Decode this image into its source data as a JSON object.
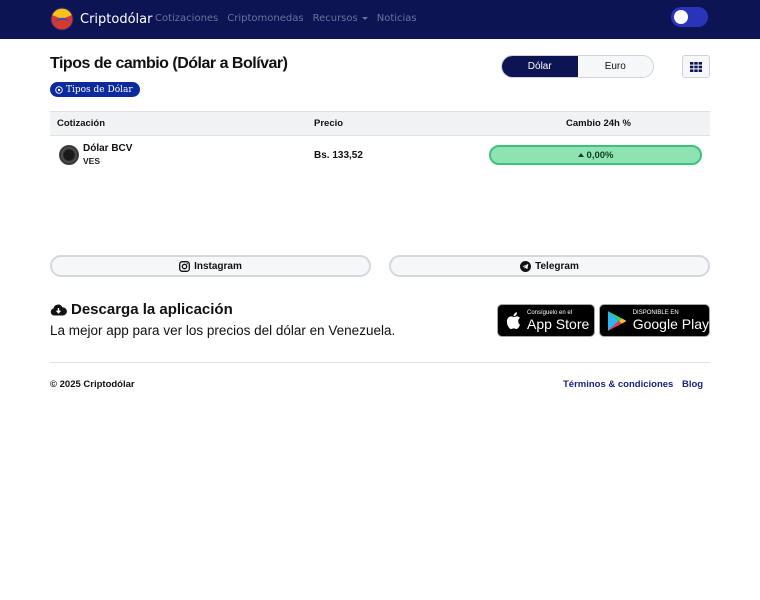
{
  "navbar": {
    "brand": "Criptodólar",
    "links": [
      "Cotizaciones",
      "Criptomonedas",
      "Recursos",
      "Noticias"
    ],
    "colors": {
      "background": "#0c1454",
      "link": "#6c7399",
      "toggle": "#2a34b8"
    }
  },
  "header": {
    "title": "Tipos de cambio (Dólar a Bolívar)",
    "currency_tabs": [
      {
        "label": "Dólar",
        "active": true
      },
      {
        "label": "Euro",
        "active": false
      }
    ],
    "grid_icon": "grid-icon",
    "badge": "Tipos de Dólar"
  },
  "table": {
    "columns": [
      "Cotización",
      "Precio",
      "Cambio 24h %"
    ],
    "rows": [
      {
        "name": "Dólar BCV",
        "code": "VES",
        "price": "Bs. 133,52",
        "change": "0,00%",
        "trend": "up"
      }
    ]
  },
  "social": {
    "instagram": "Instagram",
    "telegram": "Telegram"
  },
  "download": {
    "title": "Descarga la aplicación",
    "subtitle": "La mejor app para ver los precios del dólar en Venezuela.",
    "app_store_small": "Consíguelo en el",
    "app_store_big": "App Store",
    "google_play_small": "DISPONIBLE EN",
    "google_play_big": "Google Play"
  },
  "footer": {
    "copyright": "© 2025 Criptodólar",
    "terms": "Términos & condiciones",
    "blog": "Blog"
  }
}
